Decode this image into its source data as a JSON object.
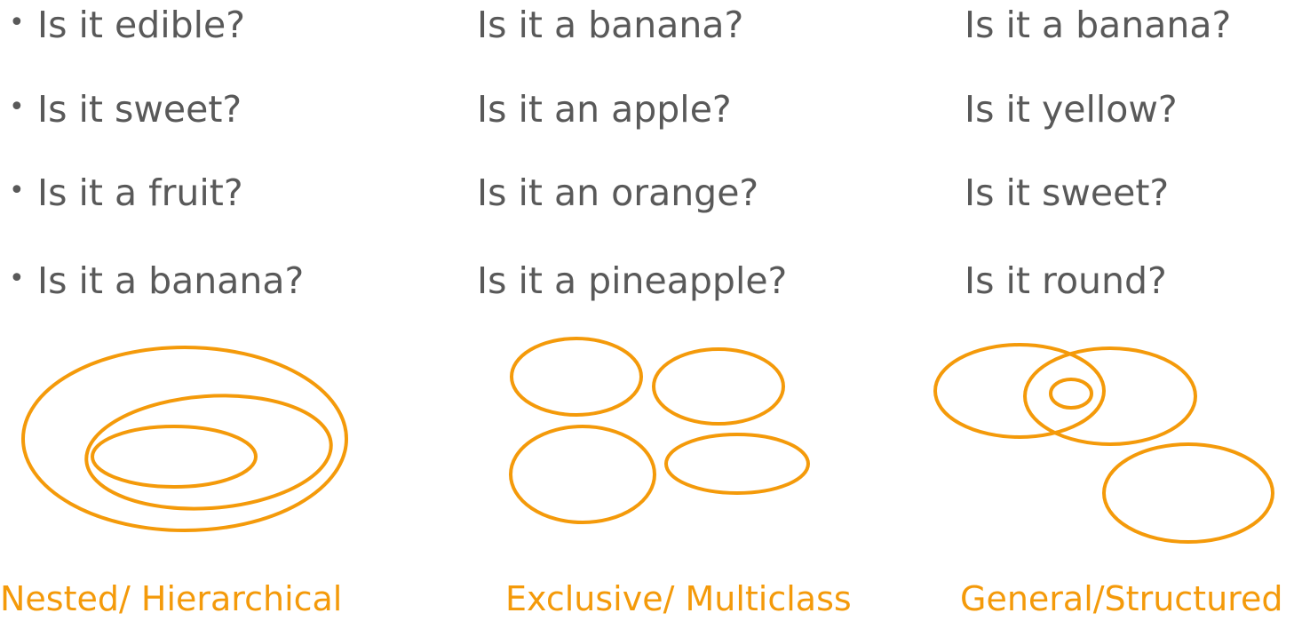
{
  "accent_color": "#F49A0A",
  "text_color": "#595959",
  "bullet_glyph": "•",
  "columns": [
    {
      "questions": [
        "Is it edible?",
        "Is it sweet?",
        "Is it a fruit?",
        "Is it a banana?"
      ],
      "caption": "Nested/ Hierarchical"
    },
    {
      "questions": [
        "Is it a banana?",
        "Is it an apple?",
        "Is it an orange?",
        "Is it a pineapple?"
      ],
      "caption": "Exclusive/ Multiclass"
    },
    {
      "questions": [
        "Is it a banana?",
        "Is it yellow?",
        "Is it sweet?",
        "Is it round?"
      ],
      "caption": "General/Structured"
    }
  ]
}
